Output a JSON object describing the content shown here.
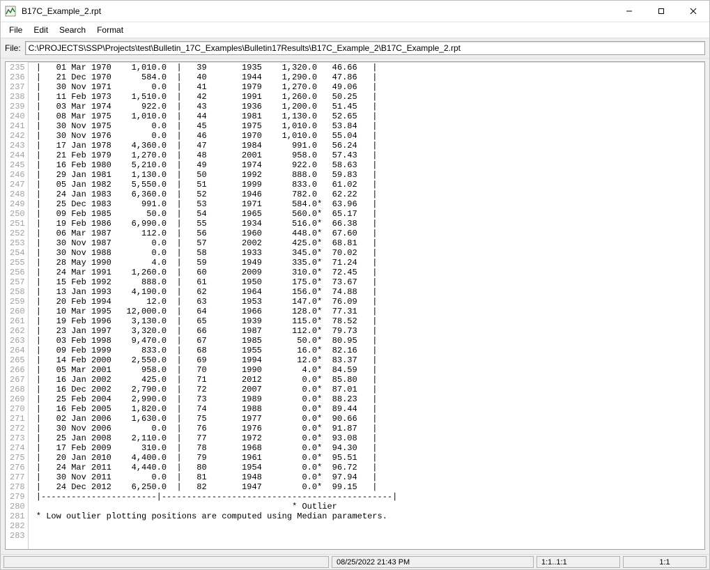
{
  "titlebar": {
    "title": "B17C_Example_2.rpt"
  },
  "menubar": {
    "items": [
      "File",
      "Edit",
      "Search",
      "Format"
    ]
  },
  "file_row": {
    "label": "File:",
    "path": "C:\\PROJECTS\\SSP\\Projects\\test\\Bulletin_17C_Examples\\Bulletin17Results\\B17C_Example_2\\B17C_Example_2.rpt"
  },
  "editor": {
    "first_line_no": 235,
    "rows": [
      {
        "date": "01 Mar 1970",
        "v1": "1,010.0",
        "idx": "39",
        "yr": "1935",
        "v2": "1,320.0",
        "pct": "46.66"
      },
      {
        "date": "21 Dec 1970",
        "v1": "584.0",
        "idx": "40",
        "yr": "1944",
        "v2": "1,290.0",
        "pct": "47.86"
      },
      {
        "date": "30 Nov 1971",
        "v1": "0.0",
        "idx": "41",
        "yr": "1979",
        "v2": "1,270.0",
        "pct": "49.06"
      },
      {
        "date": "11 Feb 1973",
        "v1": "1,510.0",
        "idx": "42",
        "yr": "1991",
        "v2": "1,260.0",
        "pct": "50.25"
      },
      {
        "date": "03 Mar 1974",
        "v1": "922.0",
        "idx": "43",
        "yr": "1936",
        "v2": "1,200.0",
        "pct": "51.45"
      },
      {
        "date": "08 Mar 1975",
        "v1": "1,010.0",
        "idx": "44",
        "yr": "1981",
        "v2": "1,130.0",
        "pct": "52.65"
      },
      {
        "date": "30 Nov 1975",
        "v1": "0.0",
        "idx": "45",
        "yr": "1975",
        "v2": "1,010.0",
        "pct": "53.84"
      },
      {
        "date": "30 Nov 1976",
        "v1": "0.0",
        "idx": "46",
        "yr": "1970",
        "v2": "1,010.0",
        "pct": "55.04"
      },
      {
        "date": "17 Jan 1978",
        "v1": "4,360.0",
        "idx": "47",
        "yr": "1984",
        "v2": "991.0",
        "pct": "56.24"
      },
      {
        "date": "21 Feb 1979",
        "v1": "1,270.0",
        "idx": "48",
        "yr": "2001",
        "v2": "958.0",
        "pct": "57.43"
      },
      {
        "date": "16 Feb 1980",
        "v1": "5,210.0",
        "idx": "49",
        "yr": "1974",
        "v2": "922.0",
        "pct": "58.63"
      },
      {
        "date": "29 Jan 1981",
        "v1": "1,130.0",
        "idx": "50",
        "yr": "1992",
        "v2": "888.0",
        "pct": "59.83"
      },
      {
        "date": "05 Jan 1982",
        "v1": "5,550.0",
        "idx": "51",
        "yr": "1999",
        "v2": "833.0",
        "pct": "61.02"
      },
      {
        "date": "24 Jan 1983",
        "v1": "6,360.0",
        "idx": "52",
        "yr": "1946",
        "v2": "782.0",
        "pct": "62.22"
      },
      {
        "date": "25 Dec 1983",
        "v1": "991.0",
        "idx": "53",
        "yr": "1971",
        "v2": "584.0*",
        "pct": "63.96"
      },
      {
        "date": "09 Feb 1985",
        "v1": "50.0",
        "idx": "54",
        "yr": "1965",
        "v2": "560.0*",
        "pct": "65.17"
      },
      {
        "date": "19 Feb 1986",
        "v1": "6,990.0",
        "idx": "55",
        "yr": "1934",
        "v2": "516.0*",
        "pct": "66.38"
      },
      {
        "date": "06 Mar 1987",
        "v1": "112.0",
        "idx": "56",
        "yr": "1960",
        "v2": "448.0*",
        "pct": "67.60"
      },
      {
        "date": "30 Nov 1987",
        "v1": "0.0",
        "idx": "57",
        "yr": "2002",
        "v2": "425.0*",
        "pct": "68.81"
      },
      {
        "date": "30 Nov 1988",
        "v1": "0.0",
        "idx": "58",
        "yr": "1933",
        "v2": "345.0*",
        "pct": "70.02"
      },
      {
        "date": "28 May 1990",
        "v1": "4.0",
        "idx": "59",
        "yr": "1949",
        "v2": "335.0*",
        "pct": "71.24"
      },
      {
        "date": "24 Mar 1991",
        "v1": "1,260.0",
        "idx": "60",
        "yr": "2009",
        "v2": "310.0*",
        "pct": "72.45"
      },
      {
        "date": "15 Feb 1992",
        "v1": "888.0",
        "idx": "61",
        "yr": "1950",
        "v2": "175.0*",
        "pct": "73.67"
      },
      {
        "date": "13 Jan 1993",
        "v1": "4,190.0",
        "idx": "62",
        "yr": "1964",
        "v2": "156.0*",
        "pct": "74.88"
      },
      {
        "date": "20 Feb 1994",
        "v1": "12.0",
        "idx": "63",
        "yr": "1953",
        "v2": "147.0*",
        "pct": "76.09"
      },
      {
        "date": "10 Mar 1995",
        "v1": "12,000.0",
        "idx": "64",
        "yr": "1966",
        "v2": "128.0*",
        "pct": "77.31"
      },
      {
        "date": "19 Feb 1996",
        "v1": "3,130.0",
        "idx": "65",
        "yr": "1939",
        "v2": "115.0*",
        "pct": "78.52"
      },
      {
        "date": "23 Jan 1997",
        "v1": "3,320.0",
        "idx": "66",
        "yr": "1987",
        "v2": "112.0*",
        "pct": "79.73"
      },
      {
        "date": "03 Feb 1998",
        "v1": "9,470.0",
        "idx": "67",
        "yr": "1985",
        "v2": "50.0*",
        "pct": "80.95"
      },
      {
        "date": "09 Feb 1999",
        "v1": "833.0",
        "idx": "68",
        "yr": "1955",
        "v2": "16.0*",
        "pct": "82.16"
      },
      {
        "date": "14 Feb 2000",
        "v1": "2,550.0",
        "idx": "69",
        "yr": "1994",
        "v2": "12.0*",
        "pct": "83.37"
      },
      {
        "date": "05 Mar 2001",
        "v1": "958.0",
        "idx": "70",
        "yr": "1990",
        "v2": "4.0*",
        "pct": "84.59"
      },
      {
        "date": "16 Jan 2002",
        "v1": "425.0",
        "idx": "71",
        "yr": "2012",
        "v2": "0.0*",
        "pct": "85.80"
      },
      {
        "date": "16 Dec 2002",
        "v1": "2,790.0",
        "idx": "72",
        "yr": "2007",
        "v2": "0.0*",
        "pct": "87.01"
      },
      {
        "date": "25 Feb 2004",
        "v1": "2,990.0",
        "idx": "73",
        "yr": "1989",
        "v2": "0.0*",
        "pct": "88.23"
      },
      {
        "date": "16 Feb 2005",
        "v1": "1,820.0",
        "idx": "74",
        "yr": "1988",
        "v2": "0.0*",
        "pct": "89.44"
      },
      {
        "date": "02 Jan 2006",
        "v1": "1,630.0",
        "idx": "75",
        "yr": "1977",
        "v2": "0.0*",
        "pct": "90.66"
      },
      {
        "date": "30 Nov 2006",
        "v1": "0.0",
        "idx": "76",
        "yr": "1976",
        "v2": "0.0*",
        "pct": "91.87"
      },
      {
        "date": "25 Jan 2008",
        "v1": "2,110.0",
        "idx": "77",
        "yr": "1972",
        "v2": "0.0*",
        "pct": "93.08"
      },
      {
        "date": "17 Feb 2009",
        "v1": "310.0",
        "idx": "78",
        "yr": "1968",
        "v2": "0.0*",
        "pct": "94.30"
      },
      {
        "date": "20 Jan 2010",
        "v1": "4,400.0",
        "idx": "79",
        "yr": "1961",
        "v2": "0.0*",
        "pct": "95.51"
      },
      {
        "date": "24 Mar 2011",
        "v1": "4,440.0",
        "idx": "80",
        "yr": "1954",
        "v2": "0.0*",
        "pct": "96.72"
      },
      {
        "date": "30 Nov 2011",
        "v1": "0.0",
        "idx": "81",
        "yr": "1948",
        "v2": "0.0*",
        "pct": "97.94"
      },
      {
        "date": "24 Dec 2012",
        "v1": "6,250.0",
        "idx": "82",
        "yr": "1947",
        "v2": "0.0*",
        "pct": "99.15"
      }
    ],
    "footer_sep": "|-----------------------|----------------------------------------------|",
    "footer_outlier": "                                                   * Outlier",
    "footer_note": " * Low outlier plotting positions are computed using Median parameters."
  },
  "statusbar": {
    "cell1": "",
    "cell2": "08/25/2022 21:43 PM",
    "cell3": "1:1..1:1",
    "cell4": "1:1"
  }
}
